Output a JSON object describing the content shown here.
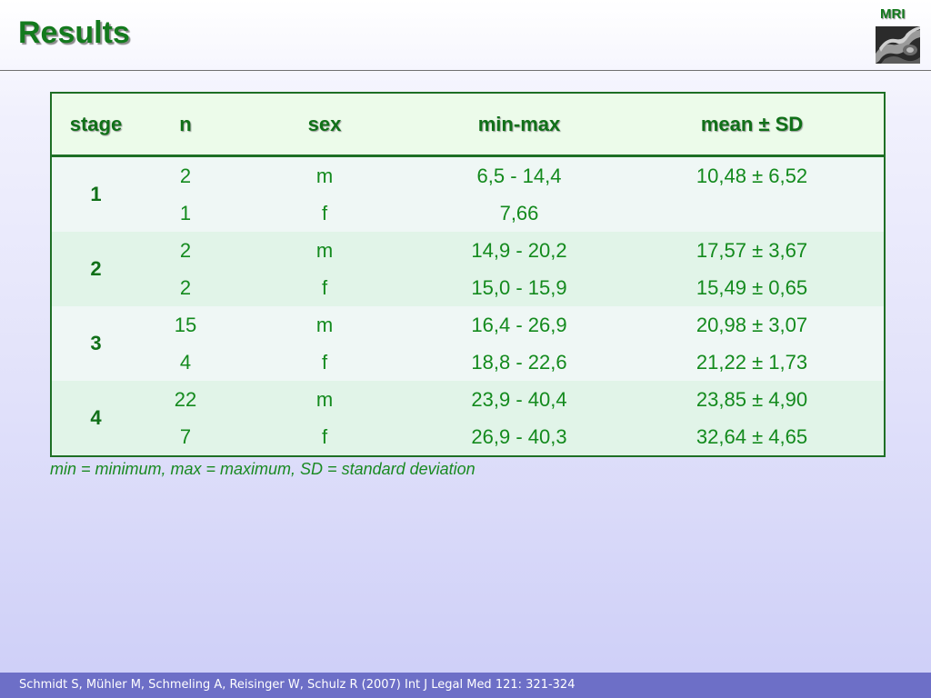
{
  "header": {
    "title": "Results",
    "corner_label": "MRI",
    "thumbnail_icon": "mri-scan-thumbnail"
  },
  "table": {
    "columns": [
      "stage",
      "n",
      "sex",
      "min-max",
      "mean ± SD"
    ],
    "groups": [
      {
        "stage": "1",
        "rows": [
          {
            "n": "2",
            "sex": "m",
            "range": "6,5 - 14,4",
            "mean_sd": "10,48 ± 6,52"
          },
          {
            "n": "1",
            "sex": "f",
            "range": "7,66",
            "mean_sd": ""
          }
        ]
      },
      {
        "stage": "2",
        "rows": [
          {
            "n": "2",
            "sex": "m",
            "range": "14,9 - 20,2",
            "mean_sd": "17,57 ± 3,67"
          },
          {
            "n": "2",
            "sex": "f",
            "range": "15,0 - 15,9",
            "mean_sd": "15,49 ± 0,65"
          }
        ]
      },
      {
        "stage": "3",
        "rows": [
          {
            "n": "15",
            "sex": "m",
            "range": "16,4 - 26,9",
            "mean_sd": "20,98 ± 3,07"
          },
          {
            "n": "4",
            "sex": "f",
            "range": "18,8 - 22,6",
            "mean_sd": "21,22 ± 1,73"
          }
        ]
      },
      {
        "stage": "4",
        "rows": [
          {
            "n": "22",
            "sex": "m",
            "range": "23,9 - 40,4",
            "mean_sd": "23,85 ± 4,90"
          },
          {
            "n": "7",
            "sex": "f",
            "range": "26,9 - 40,3",
            "mean_sd": "32,64 ± 4,65"
          }
        ]
      }
    ]
  },
  "footnote": "min = minimum, max = maximum, SD = standard deviation",
  "footer": {
    "citation": "Schmidt S, Mühler M, Schmeling A, Reisinger W, Schulz R (2007) Int J Legal Med 121: 321-324"
  },
  "colors": {
    "accent_green": "#137a1d",
    "footer_bar": "#6d6fc7",
    "table_border": "#1e6f25"
  }
}
